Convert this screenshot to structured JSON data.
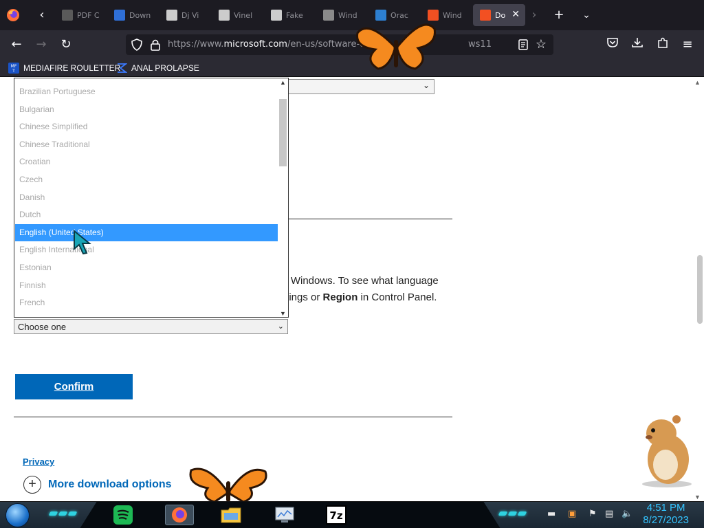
{
  "browser": {
    "tabs": [
      {
        "label": "PDF C",
        "fav_color": "#5a5a5a"
      },
      {
        "label": "Down",
        "fav_color": "#2f6fd6"
      },
      {
        "label": "Dj Vi",
        "fav_color": "#cccccc"
      },
      {
        "label": "Vinel",
        "fav_color": "#cccccc"
      },
      {
        "label": "Fake",
        "fav_color": "#cccccc"
      },
      {
        "label": "Wind",
        "fav_color": "#8a8a8a"
      },
      {
        "label": "Orac",
        "fav_color": "#2d7fd0"
      },
      {
        "label": "Wind",
        "fav_color": "#f25022"
      },
      {
        "label": "Do",
        "fav_color": "#f25022",
        "active": true
      }
    ],
    "url_prefix": "https://www.",
    "url_host": "microsoft.com",
    "url_path": "/en-us/software-dow",
    "url_tail": "ws11",
    "bookmarks": [
      {
        "label": "MEDIAFIRE ROULETTER",
        "icon": "mediafire-icon"
      },
      {
        "label": "ANAL PROLAPSE",
        "icon": "sigma-icon"
      }
    ]
  },
  "page": {
    "info_line1": "ll Windows. To see what language",
    "info_line2_pre": "ttings or ",
    "info_line2_bold": "Region",
    "info_line2_post": " in Control Panel.",
    "language_select_value": "Choose one",
    "confirm_label": "Confirm",
    "privacy_label": "Privacy",
    "more_label": "More download options",
    "more_icon": "+"
  },
  "dropdown": {
    "items": [
      "Brazilian Portuguese",
      "Bulgarian",
      "Chinese Simplified",
      "Chinese Traditional",
      "Croatian",
      "Czech",
      "Danish",
      "Dutch",
      "English (United States)",
      "English International",
      "Estonian",
      "Finnish",
      "French"
    ],
    "selected_index": 8
  },
  "taskbar": {
    "time": "4:51 PM",
    "date": "8/27/2023",
    "apps": [
      {
        "name": "spotify",
        "icon": "spotify-icon"
      },
      {
        "name": "firefox",
        "icon": "firefox-icon",
        "active": true
      },
      {
        "name": "file-explorer",
        "icon": "folder-icon"
      },
      {
        "name": "performance",
        "icon": "monitor-icon"
      },
      {
        "name": "7zip",
        "icon": "7zip-icon",
        "label": "7z"
      }
    ]
  },
  "colors": {
    "accent": "#0067b8",
    "selection": "#3399ff",
    "clock": "#34c4ff"
  }
}
